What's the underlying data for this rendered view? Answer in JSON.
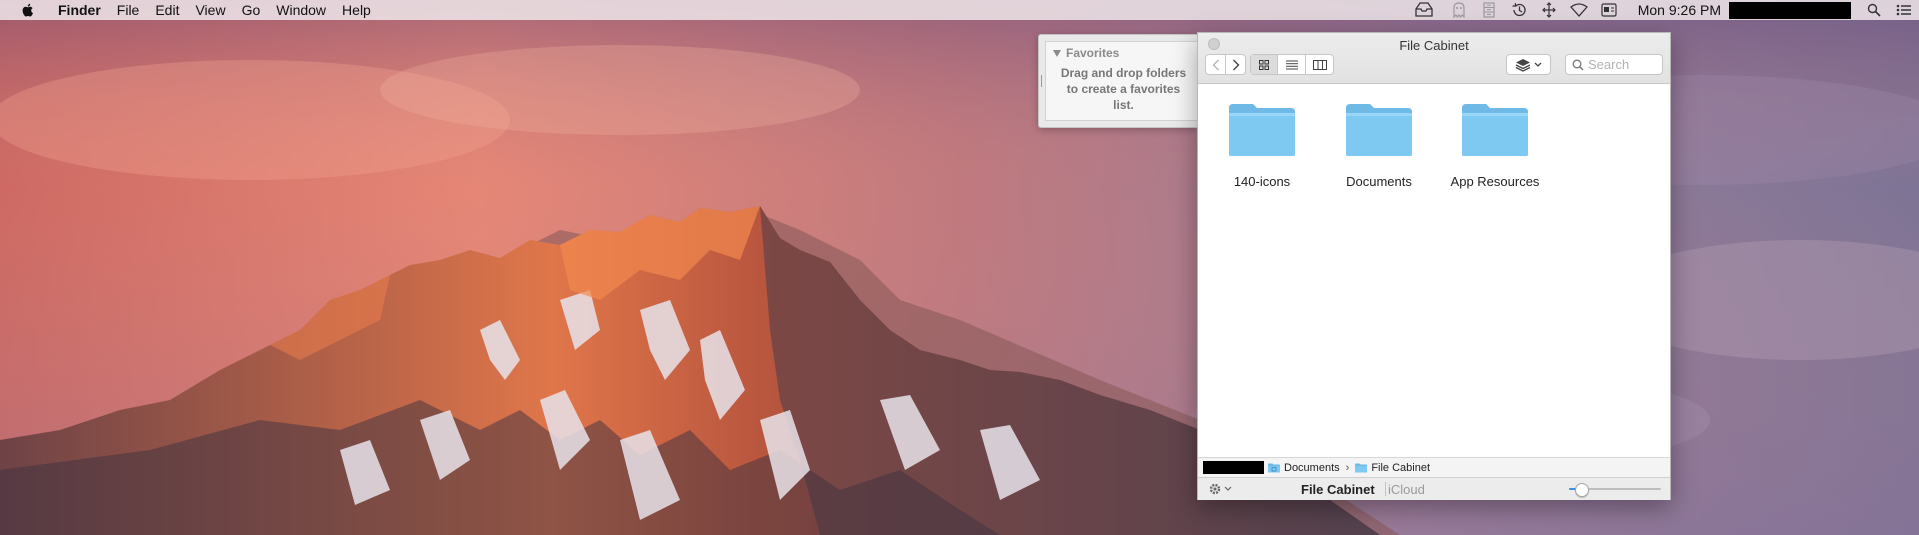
{
  "menubar": {
    "app_name": "Finder",
    "items": [
      "File",
      "Edit",
      "View",
      "Go",
      "Window",
      "Help"
    ],
    "clock": "Mon 9:26 PM",
    "status_icons": [
      "file-cabinet-inbox-icon",
      "ghost-icon",
      "cabinet-drawers-icon",
      "time-machine-icon",
      "move-arrows-icon",
      "wifi-icon",
      "input-menu-icon"
    ]
  },
  "drawer": {
    "header": "Favorites",
    "hint": "Drag and drop folders to create a favorites list."
  },
  "window": {
    "title": "File Cabinet",
    "view_modes": [
      "icon-view",
      "list-view",
      "column-view"
    ],
    "active_view": "icon-view",
    "search_placeholder": "Search",
    "items": [
      {
        "label": "140-icons",
        "icon": "folder-icon"
      },
      {
        "label": "Documents",
        "icon": "folder-icon"
      },
      {
        "label": "App Resources",
        "icon": "folder-icon"
      }
    ],
    "path": [
      "Documents",
      "File Cabinet"
    ],
    "status_name": "File Cabinet",
    "status_location": "iCloud",
    "icon_size": 0.08
  },
  "colors": {
    "folder": "#7ec9f2",
    "folder_tab": "#6fb9e6",
    "accent": "#3b8ee8"
  }
}
